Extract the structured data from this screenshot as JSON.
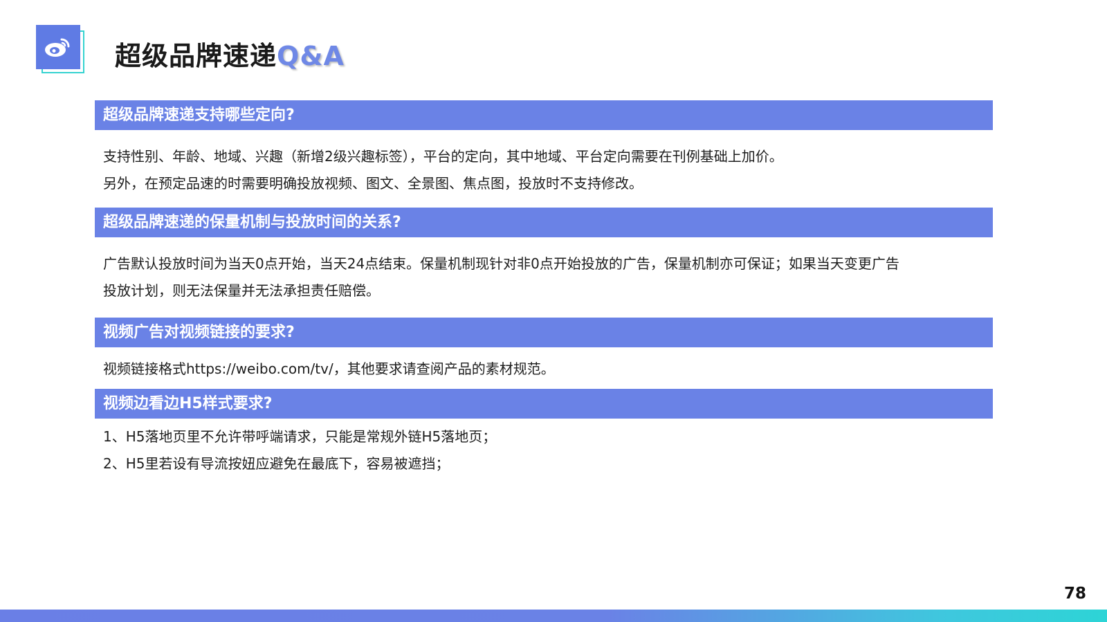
{
  "header": {
    "title_main": "超级品牌速递",
    "title_accent": "Q&A"
  },
  "sections": [
    {
      "heading": "超级品牌速递支持哪些定向?",
      "lines": [
        "支持性别、年龄、地域、兴趣（新增2级兴趣标签），平台的定向，其中地域、平台定向需要在刊例基础上加价。",
        "另外，在预定品速的时需要明确投放视频、图文、全景图、焦点图，投放时不支持修改。"
      ]
    },
    {
      "heading": "超级品牌速递的保量机制与投放时间的关系?",
      "lines": [
        "广告默认投放时间为当天0点开始，当天24点结束。保量机制现针对非0点开始投放的广告，保量机制亦可保证；如果当天变更广告",
        "投放计划，则无法保量并无法承担责任赔偿。"
      ]
    },
    {
      "heading": "视频广告对视频链接的要求?",
      "lines": [
        "视频链接格式https://weibo.com/tv/，其他要求请查阅产品的素材规范。"
      ]
    },
    {
      "heading": "视频边看边H5样式要求?",
      "lines": [
        "1、H5落地页里不允许带呼端请求，只能是常规外链H5落地页；",
        "2、H5里若设有导流按妞应避免在最底下，容易被遮挡；"
      ]
    }
  ],
  "page_number": "78",
  "icons": {
    "logo": "weibo-logo-icon"
  },
  "colors": {
    "accent": "#6a82e6",
    "logo_outline": "#34d3d0"
  }
}
